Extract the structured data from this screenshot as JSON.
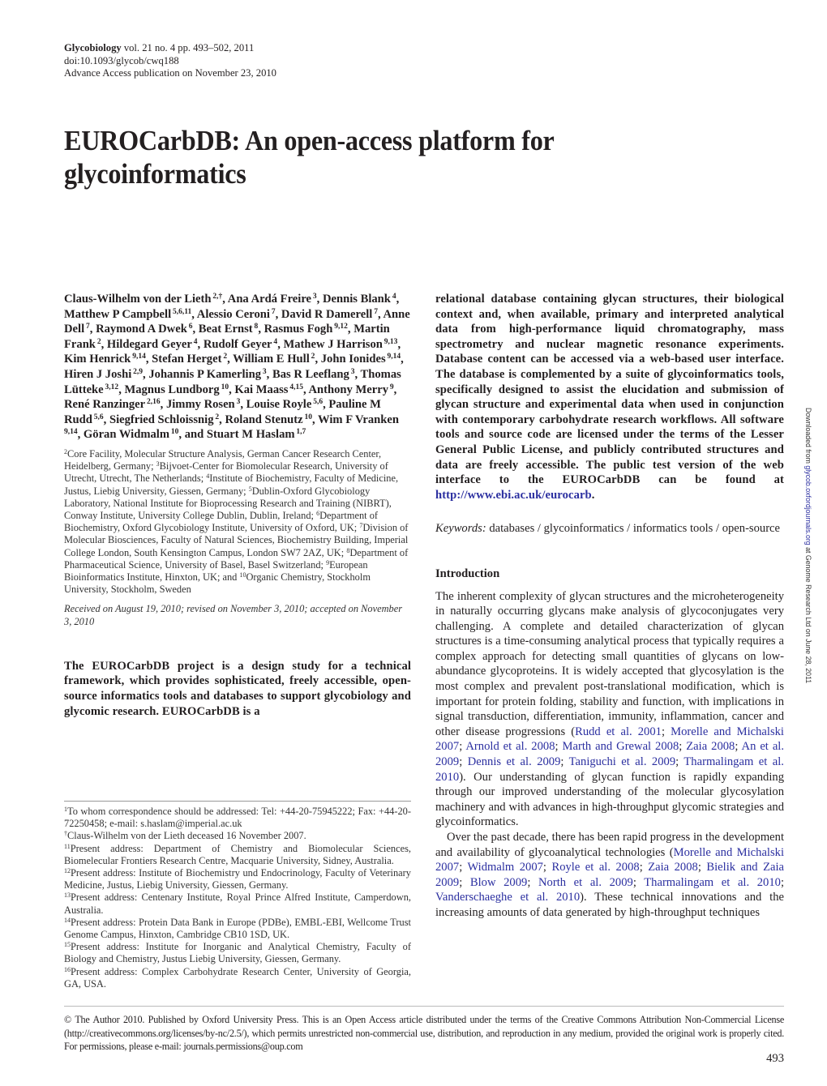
{
  "header": {
    "journal": "Glycobiology",
    "citation": "vol. 21 no. 4 pp. 493–502, 2011",
    "doi": "doi:10.1093/glycob/cwq188",
    "advance_access": "Advance Access publication on November 23, 2010"
  },
  "title": {
    "line1": "EUROCarbDB: An open-access platform for",
    "line2": "glycoinformatics"
  },
  "authors": [
    {
      "name": "Claus-Wilhelm von der Lieth",
      "aff": "2,†"
    },
    {
      "name": "Ana Ardá Freire",
      "aff": "3"
    },
    {
      "name": "Dennis Blank",
      "aff": "4"
    },
    {
      "name": "Matthew P Campbell",
      "aff": "5,6,11"
    },
    {
      "name": "Alessio Ceroni",
      "aff": "7"
    },
    {
      "name": "David R Damerell",
      "aff": "7"
    },
    {
      "name": "Anne Dell",
      "aff": "7"
    },
    {
      "name": "Raymond A Dwek",
      "aff": "6"
    },
    {
      "name": "Beat Ernst",
      "aff": "8"
    },
    {
      "name": "Rasmus Fogh",
      "aff": "9,12"
    },
    {
      "name": "Martin Frank",
      "aff": "2"
    },
    {
      "name": "Hildegard Geyer",
      "aff": "4"
    },
    {
      "name": "Rudolf Geyer",
      "aff": "4"
    },
    {
      "name": "Mathew J Harrison",
      "aff": "9,13"
    },
    {
      "name": "Kim Henrick",
      "aff": "9,14"
    },
    {
      "name": "Stefan Herget",
      "aff": "2"
    },
    {
      "name": "William E Hull",
      "aff": "2"
    },
    {
      "name": "John Ionides",
      "aff": "9,14"
    },
    {
      "name": "Hiren J Joshi",
      "aff": "2,9"
    },
    {
      "name": "Johannis P Kamerling",
      "aff": "3"
    },
    {
      "name": "Bas R Leeflang",
      "aff": "3"
    },
    {
      "name": "Thomas Lütteke",
      "aff": "3,12"
    },
    {
      "name": "Magnus Lundborg",
      "aff": "10"
    },
    {
      "name": "Kai Maass",
      "aff": "4,15"
    },
    {
      "name": "Anthony Merry",
      "aff": "9"
    },
    {
      "name": "René Ranzinger",
      "aff": "2,16"
    },
    {
      "name": "Jimmy Rosen",
      "aff": "3"
    },
    {
      "name": "Louise Royle",
      "aff": "5,6"
    },
    {
      "name": "Pauline M Rudd",
      "aff": "5,6"
    },
    {
      "name": "Siegfried Schloissnig",
      "aff": "2"
    },
    {
      "name": "Roland Stenutz",
      "aff": "10"
    },
    {
      "name": "Wim F Vranken",
      "aff": "9,14"
    },
    {
      "name": "Göran Widmalm",
      "aff": "10"
    },
    {
      "name": "and Stuart M Haslam",
      "aff": "1,7"
    }
  ],
  "affiliations": [
    {
      "num": "2",
      "text": "Core Facility, Molecular Structure Analysis, German Cancer Research Center, Heidelberg, Germany; "
    },
    {
      "num": "3",
      "text": "Bijvoet-Center for Biomolecular Research, University of Utrecht, Utrecht, The Netherlands; "
    },
    {
      "num": "4",
      "text": "Institute of Biochemistry, Faculty of Medicine, Justus, Liebig University, Giessen, Germany; "
    },
    {
      "num": "5",
      "text": "Dublin-Oxford Glycobiology Laboratory, National Institute for Bioprocessing Research and Training (NIBRT), Conway Institute, University College Dublin, Dublin, Ireland; "
    },
    {
      "num": "6",
      "text": "Department of Biochemistry, Oxford Glycobiology Institute, University of Oxford, UK; "
    },
    {
      "num": "7",
      "text": "Division of Molecular Biosciences, Faculty of Natural Sciences, Biochemistry Building, Imperial College London, South Kensington Campus, London SW7 2AZ, UK; "
    },
    {
      "num": "8",
      "text": "Department of Pharmaceutical Science, University of Basel, Basel Switzerland; "
    },
    {
      "num": "9",
      "text": "European Bioinformatics Institute, Hinxton, UK; and "
    },
    {
      "num": "10",
      "text": "Organic Chemistry, Stockholm University, Stockholm, Sweden"
    }
  ],
  "received": "Received on August 19, 2010; revised on November 3, 2010; accepted on November 3, 2010",
  "abstract": {
    "left": "The EUROCarbDB project is a design study for a technical framework, which provides sophisticated, freely accessible, open-source informatics tools and databases to support glycobiology and glycomic research. EUROCarbDB is a",
    "right": "relational database containing glycan structures, their biological context and, when available, primary and interpreted analytical data from high-performance liquid chromatography, mass spectrometry and nuclear magnetic resonance experiments. Database content can be accessed via a web-based user interface. The database is complemented by a suite of glycoinformatics tools, specifically designed to assist the elucidation and submission of glycan structure and experimental data when used in conjunction with contemporary carbohydrate research workflows. All software tools and source code are licensed under the terms of the Lesser General Public License, and publicly contributed structures and data are freely accessible. The public test version of the web interface to the EUROCarbDB can be found at ",
    "url": "http://www.ebi.ac.uk/eurocarb",
    "url_suffix": "."
  },
  "keywords": {
    "label": "Keywords:",
    "text": " databases / glycoinformatics / informatics tools / open-source"
  },
  "footnotes": [
    {
      "num": "1",
      "text": "To whom correspondence should be addressed: Tel: +44-20-75945222; Fax: +44-20-72250458; e-mail: s.haslam@imperial.ac.uk"
    },
    {
      "num": "†",
      "text": "Claus-Wilhelm von der Lieth deceased 16 November 2007."
    },
    {
      "num": "11",
      "text": "Present address: Department of Chemistry and Biomolecular Sciences, Biomelecular Frontiers Research Centre, Macquarie University, Sidney, Australia."
    },
    {
      "num": "12",
      "text": "Present address: Institute of Biochemistry und Endocrinology, Faculty of Veterinary Medicine, Justus, Liebig University, Giessen, Germany."
    },
    {
      "num": "13",
      "text": "Present address: Centenary Institute, Royal Prince Alfred Institute, Camperdown, Australia."
    },
    {
      "num": "14",
      "text": "Present address: Protein Data Bank in Europe (PDBe), EMBL-EBI, Wellcome Trust Genome Campus, Hinxton, Cambridge CB10 1SD, UK."
    },
    {
      "num": "15",
      "text": "Present address: Institute for Inorganic and Analytical Chemistry, Faculty of Biology and Chemistry, Justus Liebig University, Giessen, Germany."
    },
    {
      "num": "16",
      "text": "Present address: Complex Carbohydrate Research Center, University of Georgia, GA, USA."
    }
  ],
  "introduction": {
    "heading": "Introduction",
    "p1_text": "The inherent complexity of glycan structures and the microheterogeneity in naturally occurring glycans make analysis of glycoconjugates very challenging. A complete and detailed characterization of glycan structures is a time-consuming analytical process that typically requires a complex approach for detecting small quantities of glycans on low-abundance glycoproteins. It is widely accepted that glycosylation is the most complex and prevalent post-translational modification, which is important for protein folding, stability and function, with implications in signal transduction, differentiation, immunity, inflammation, cancer and other disease progressions (",
    "p1_citations": [
      "Rudd et al. 2001",
      "Morelle and Michalski 2007",
      "Arnold et al. 2008",
      "Marth and Grewal 2008",
      "Zaia 2008",
      "An et al. 2009",
      "Dennis et al. 2009",
      "Taniguchi et al. 2009",
      "Tharmalingam et al. 2010"
    ],
    "p1_after": "). Our understanding of glycan function is rapidly expanding through our improved understanding of the molecular glycosylation machinery and with advances in high-throughput glycomic strategies and glycoinformatics.",
    "p2_text": "Over the past decade, there has been rapid progress in the development and availability of glycoanalytical technologies (",
    "p2_citations": [
      "Morelle and Michalski 2007",
      "Widmalm 2007",
      "Royle et al. 2008",
      "Zaia 2008",
      "Bielik and Zaia 2009",
      "Blow 2009",
      "North et al. 2009",
      "Tharmalingam et al. 2010",
      "Vanderschaeghe et al. 2010"
    ],
    "p2_after": "). These technical innovations and the increasing amounts of data generated by high-throughput techniques"
  },
  "license": "© The Author 2010. Published by Oxford University Press. This is an Open Access article distributed under the terms of the Creative Commons Attribution Non-Commercial License (http://creativecommons.org/licenses/by-nc/2.5/), which permits unrestricted non-commercial use, distribution, and reproduction in any medium, provided the original work is properly cited. For permissions, please e-mail: journals.permissions@oup.com",
  "page_number": "493",
  "side_note": {
    "prefix": "Downloaded from ",
    "link": "glycob.oxfordjournals.org",
    "suffix": " at Genome Research Ltd on June 28, 2011"
  },
  "colors": {
    "link": "#2b2fa0",
    "text": "#231f20"
  }
}
